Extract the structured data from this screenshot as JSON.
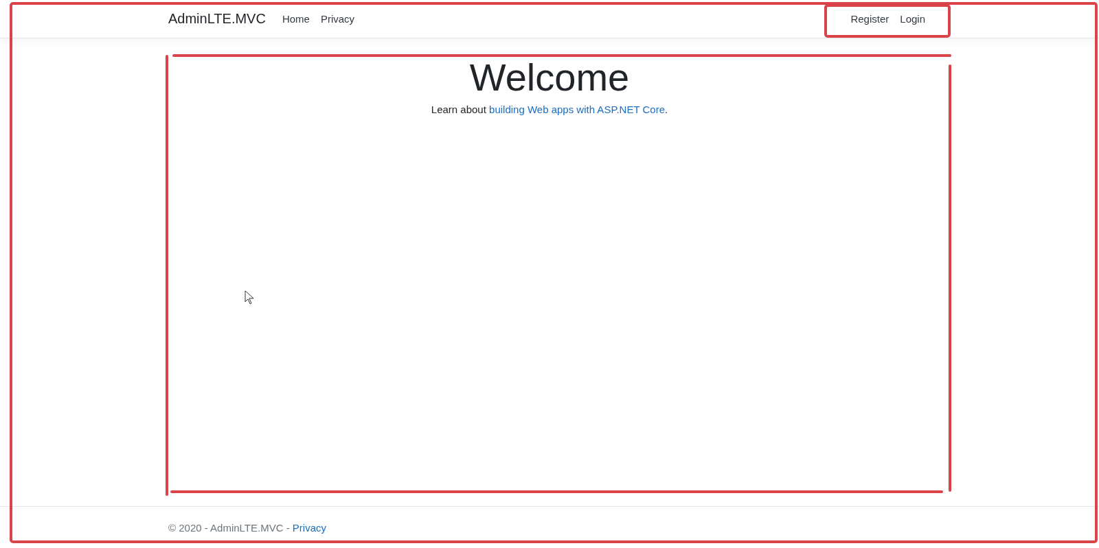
{
  "navbar": {
    "brand": "AdminLTE.MVC",
    "links": [
      {
        "label": "Home"
      },
      {
        "label": "Privacy"
      }
    ],
    "account_links": [
      {
        "label": "Register"
      },
      {
        "label": "Login"
      }
    ]
  },
  "main": {
    "heading": "Welcome",
    "lead": {
      "before": "Learn about ",
      "link": "building Web apps with ASP.NET Core",
      "after": "."
    }
  },
  "footer": {
    "text": "© 2020 - AdminLTE.MVC - ",
    "link": "Privacy"
  }
}
